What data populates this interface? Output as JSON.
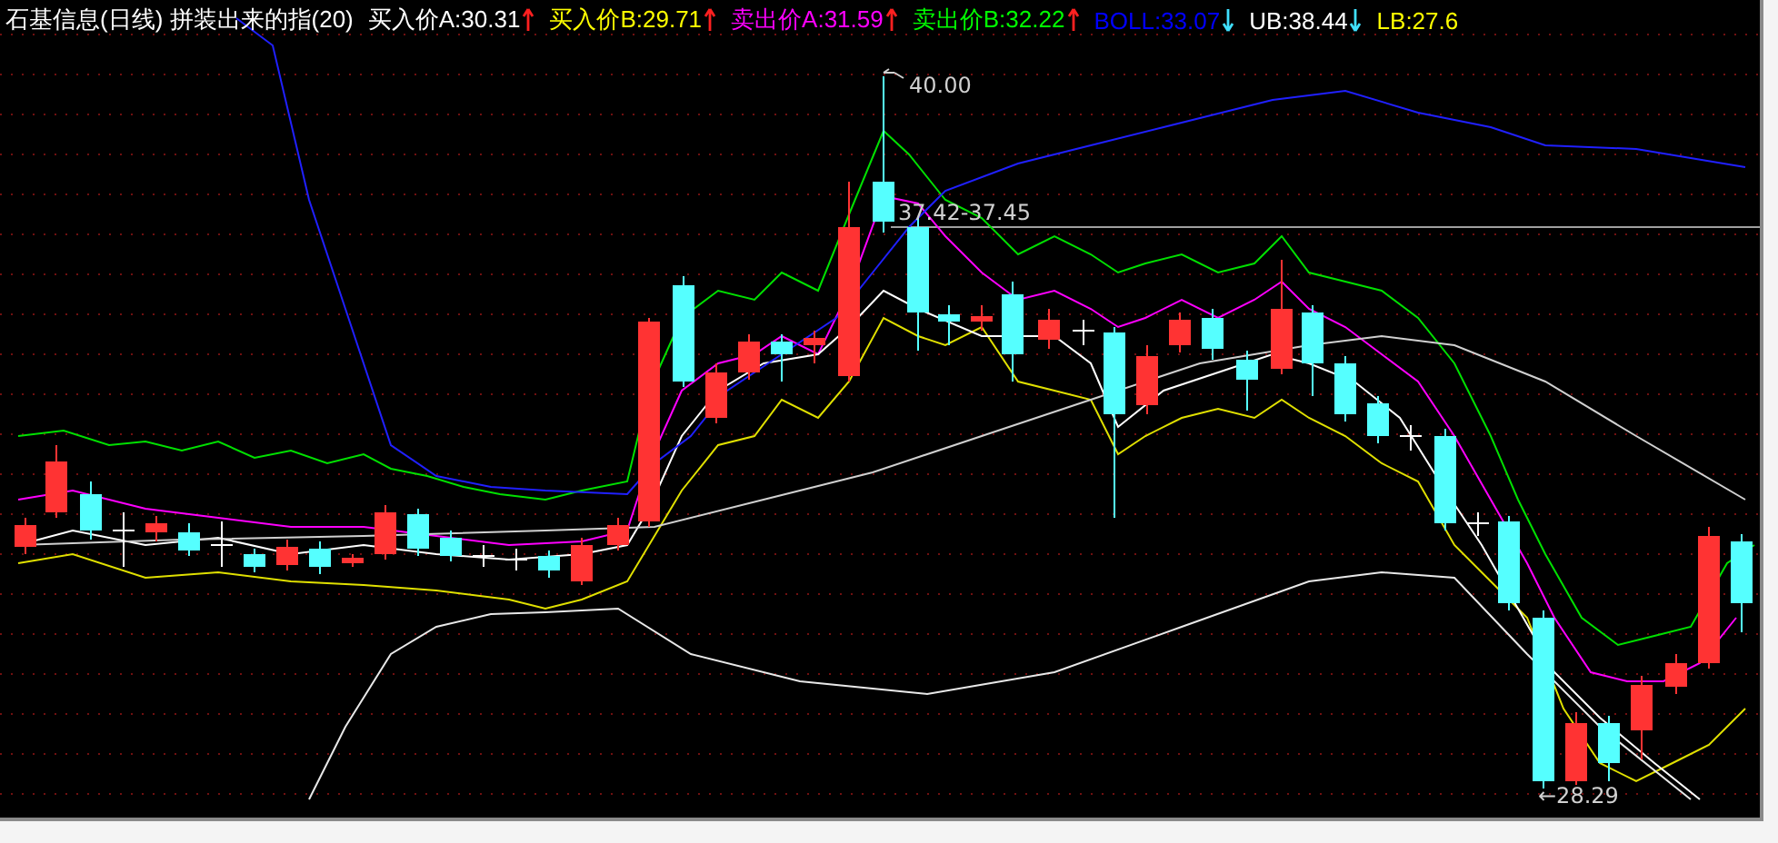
{
  "header": {
    "title": "石基信息(日线) 拼装出来的指(20)",
    "indicators": [
      {
        "label": "买入价A:30.31",
        "color": "#ffffff",
        "arrow": {
          "rising": true
        }
      },
      {
        "label": "买入价B:29.71",
        "color": "#ffff00",
        "arrow": {
          "rising": true
        }
      },
      {
        "label": "卖出价A:31.59",
        "color": "#ff00ff",
        "arrow": {
          "rising": true
        }
      },
      {
        "label": "卖出价B:32.22",
        "color": "#00ff00",
        "arrow": {
          "rising": true
        }
      },
      {
        "label": "BOLL:33.07",
        "color": "#0000ff",
        "arrow": {
          "rising": false
        }
      },
      {
        "label": "UB:38.44",
        "color": "#ffffff",
        "arrow": {
          "rising": false
        }
      },
      {
        "label": "LB:27.6",
        "color": "#ffff00"
      }
    ]
  },
  "chart": {
    "annotations": [
      {
        "text": "40.00"
      },
      {
        "text": "37.42-37.45"
      },
      {
        "text": "←28.29"
      }
    ]
  }
}
